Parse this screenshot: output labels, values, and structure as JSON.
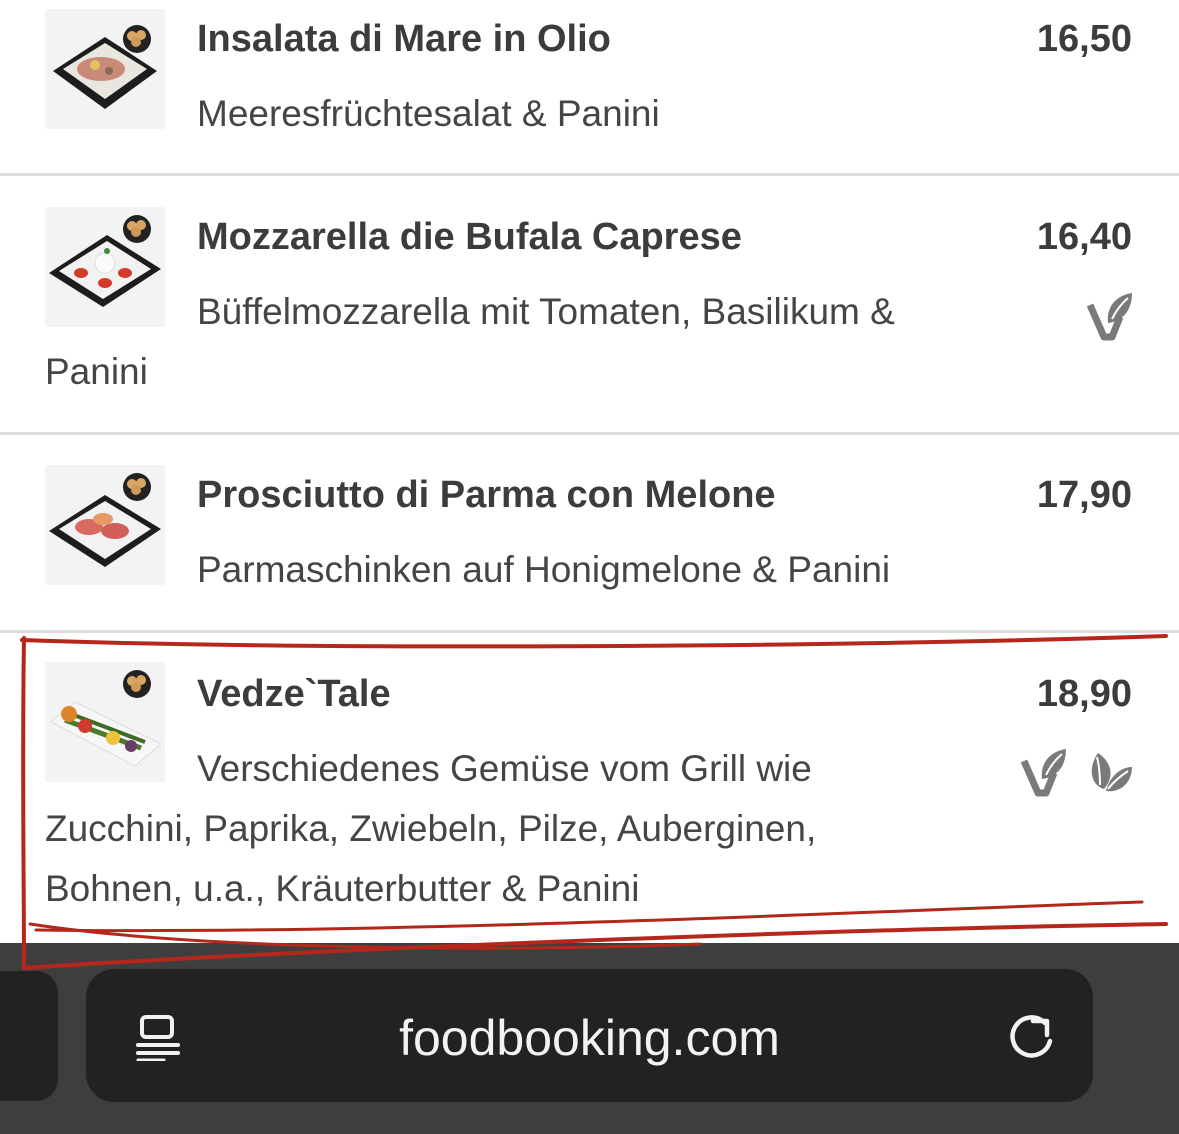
{
  "menu_items": [
    {
      "title": "Insalata di Mare in Olio",
      "price": "16,50",
      "description_lines": [
        "Meeresfrüchtesalat & Panini"
      ],
      "image": "seafood-salad-photo",
      "diet_icons": []
    },
    {
      "title": "Mozzarella die Bufala Caprese",
      "price": "16,40",
      "description_lines": [
        "Büffelmozzarella mit Tomaten, Basilikum &",
        "Panini"
      ],
      "image": "caprese-photo",
      "diet_icons": [
        "vegetarian-icon"
      ]
    },
    {
      "title": "Prosciutto di Parma con Melone",
      "price": "17,90",
      "description_lines": [
        "Parmaschinken auf Honigmelone & Panini"
      ],
      "image": "prosciutto-melon-photo",
      "diet_icons": []
    },
    {
      "title": "Vedze`Tale",
      "price": "18,90",
      "description_lines": [
        "Verschiedenes Gemüse vom Grill wie",
        "Zucchini, Paprika, Zwiebeln, Pilze, Auberginen,",
        "Bohnen, u.a., Kräuterbutter & Panini"
      ],
      "image": "grilled-vegetables-photo",
      "diet_icons": [
        "vegetarian-icon",
        "vegan-icon"
      ]
    }
  ],
  "browser": {
    "url": "foodbooking.com"
  },
  "colors": {
    "annotation": "#b5271b",
    "icon_gray": "#7a7a7a",
    "toolbar": "#3e3e3e",
    "pill": "#222222"
  }
}
